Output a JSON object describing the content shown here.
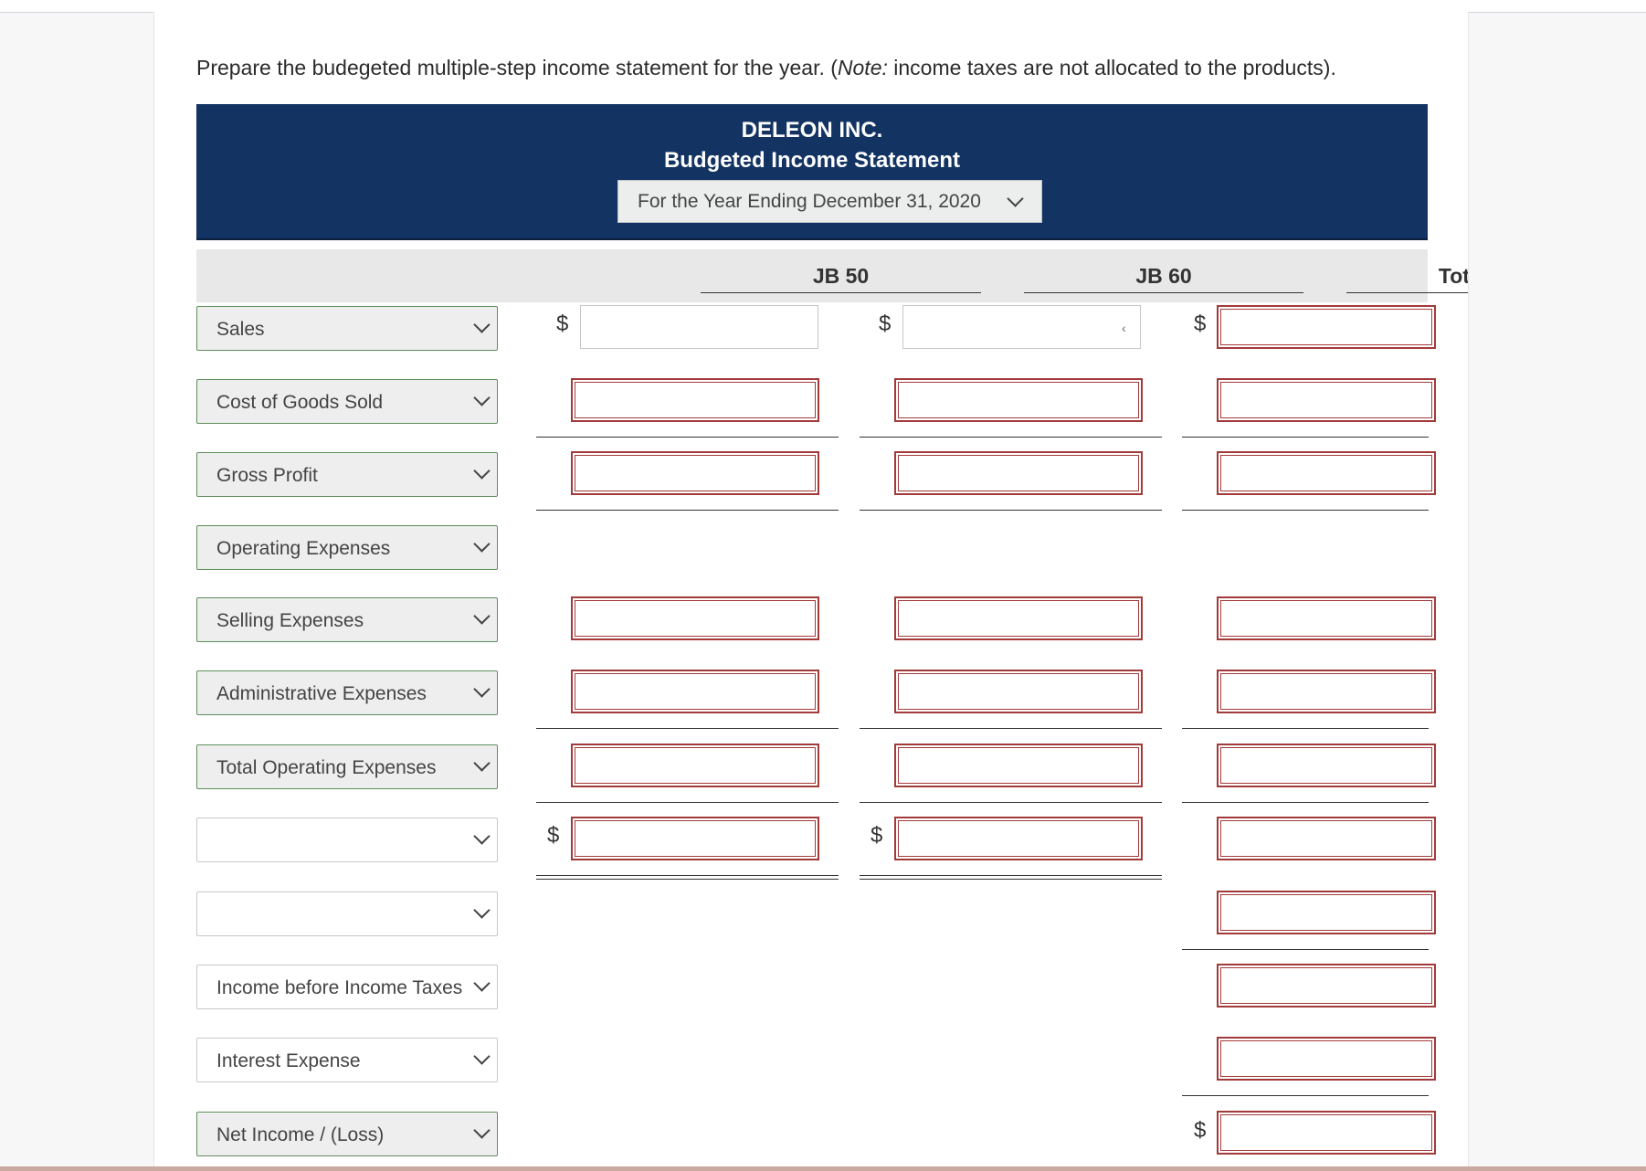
{
  "instruction": {
    "before_note": "Prepare the budegeted multiple-step income statement for the year. (",
    "note": "Note:",
    "after_note": " income taxes are not allocated to the products)."
  },
  "statement": {
    "company": "DELEON INC.",
    "title": "Budgeted Income Statement",
    "period": "For the Year Ending December 31, 2020"
  },
  "columns": [
    "JB 50",
    "JB 60",
    "Total"
  ],
  "currency_symbol": "$",
  "rows": [
    "Sales",
    "Cost of Goods Sold",
    "Gross Profit",
    "Operating Expenses",
    "Selling Expenses",
    "Administrative Expenses",
    "Total Operating Expenses",
    "",
    "",
    "Income before Income Taxes",
    "Interest Expense",
    "Net Income / (Loss)"
  ],
  "colors": {
    "header_bg": "#133462",
    "error_border": "#a33a3a",
    "label_border": "#5e8e5a"
  }
}
